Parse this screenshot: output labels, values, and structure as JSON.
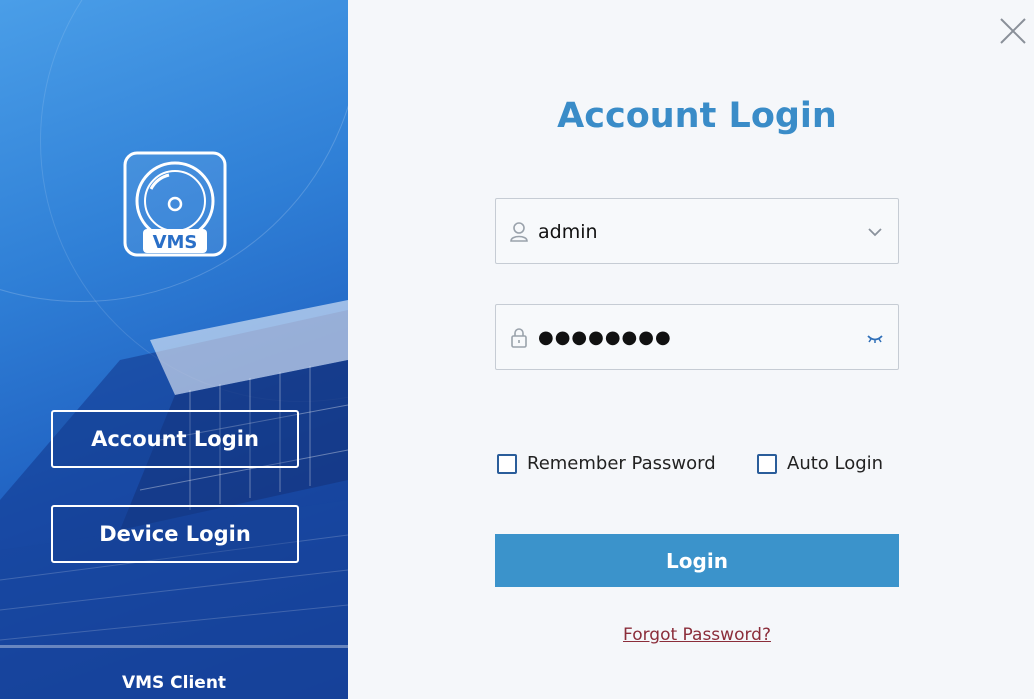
{
  "sidebar": {
    "logo_text": "VMS",
    "account_login_label": "Account Login",
    "device_login_label": "Device Login",
    "client_label": "VMS Client"
  },
  "form": {
    "title": "Account Login",
    "username_value": "admin",
    "password_value": "●●●●●●●●",
    "remember_label": "Remember Password",
    "remember_checked": false,
    "auto_login_label": "Auto Login",
    "auto_login_checked": false,
    "login_label": "Login",
    "forgot_label": "Forgot Password?"
  },
  "icons": {
    "close": "close-icon",
    "user": "user-icon",
    "lock": "lock-icon",
    "dropdown": "chevron-down-icon",
    "logo": "camera-logo-icon"
  },
  "colors": {
    "accent": "#3b93cb",
    "title": "#3a8cc8",
    "link": "#8b2d3a",
    "sidebar": "#2f7fd6"
  }
}
